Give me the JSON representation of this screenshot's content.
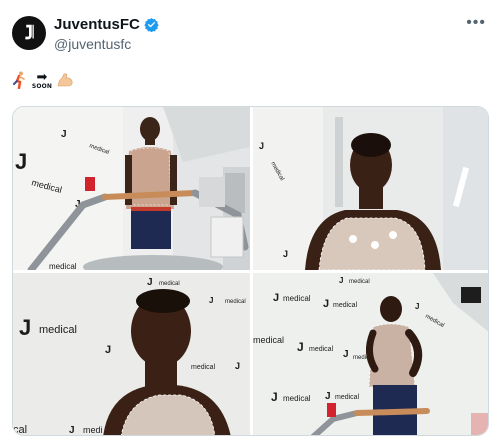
{
  "account": {
    "display_name": "JuventusFC",
    "handle": "@juventusfc",
    "verified": true,
    "avatar_icon": "juventus-j-logo-icon",
    "more_icon": "more-options-icon"
  },
  "tweet": {
    "emojis": [
      "person-running",
      "arrow-soon",
      "flexed-biceps"
    ],
    "soon_label": "SOON"
  },
  "media": {
    "wall_brand": "medical",
    "photos": [
      {
        "name": "photo-treadmill-wide"
      },
      {
        "name": "photo-closeup-electrodes"
      },
      {
        "name": "photo-closeup-looking-up"
      },
      {
        "name": "photo-running-treadmill"
      }
    ]
  },
  "colors": {
    "verified_blue": "#1d9bf0",
    "text_primary": "#0f1419",
    "text_secondary": "#536471",
    "border": "#cfd9de"
  }
}
